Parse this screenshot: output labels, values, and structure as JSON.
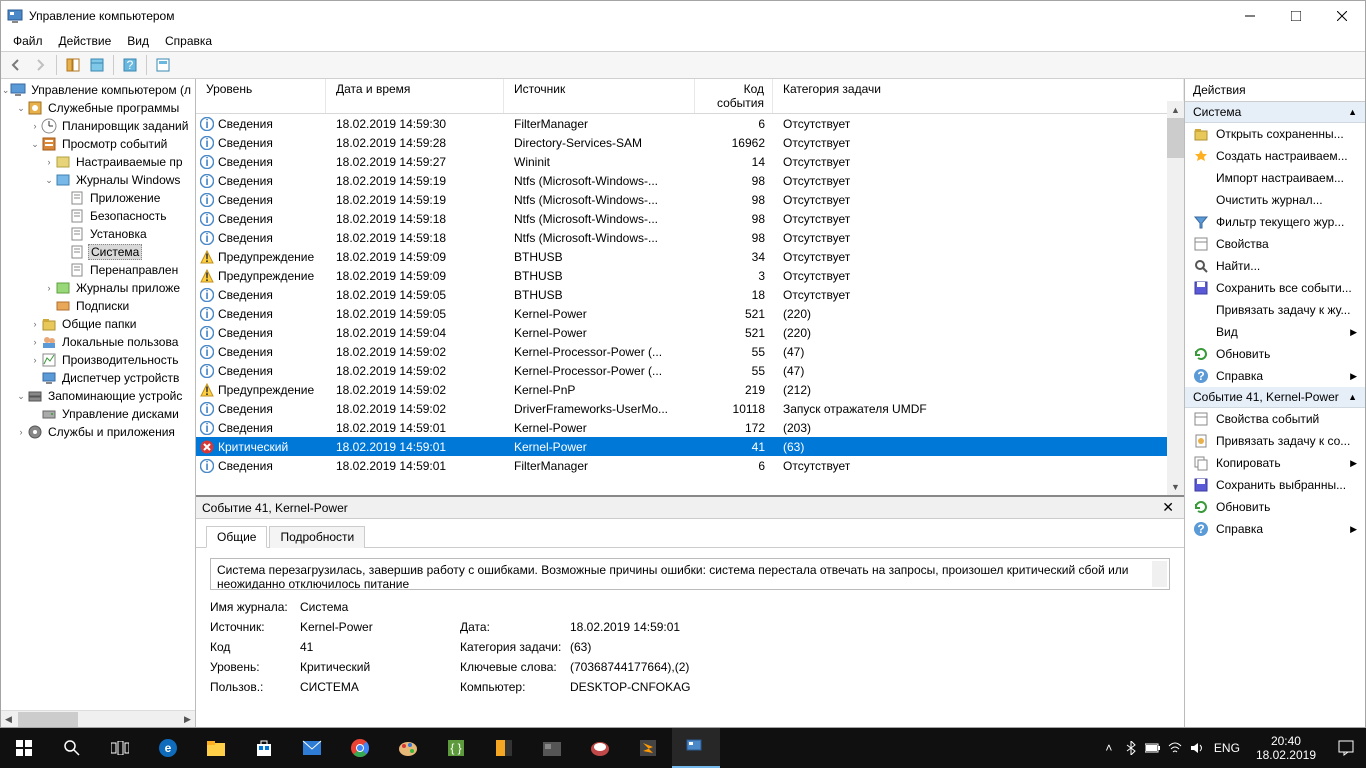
{
  "window": {
    "title": "Управление компьютером"
  },
  "menu": {
    "file": "Файл",
    "action": "Действие",
    "view": "Вид",
    "help": "Справка"
  },
  "tree": [
    {
      "d": 0,
      "exp": "v",
      "ico": "computer",
      "label": "Управление компьютером (л"
    },
    {
      "d": 1,
      "exp": "v",
      "ico": "tools",
      "label": "Служебные программы"
    },
    {
      "d": 2,
      "exp": ">",
      "ico": "sched",
      "label": "Планировщик заданий"
    },
    {
      "d": 2,
      "exp": "v",
      "ico": "event",
      "label": "Просмотр событий"
    },
    {
      "d": 3,
      "exp": ">",
      "ico": "custom",
      "label": "Настраиваемые пр"
    },
    {
      "d": 3,
      "exp": "v",
      "ico": "winlog",
      "label": "Журналы Windows"
    },
    {
      "d": 4,
      "exp": "",
      "ico": "log",
      "label": "Приложение"
    },
    {
      "d": 4,
      "exp": "",
      "ico": "log",
      "label": "Безопасность"
    },
    {
      "d": 4,
      "exp": "",
      "ico": "log",
      "label": "Установка"
    },
    {
      "d": 4,
      "exp": "",
      "ico": "log",
      "label": "Система",
      "sel": true
    },
    {
      "d": 4,
      "exp": "",
      "ico": "log",
      "label": "Перенаправлен"
    },
    {
      "d": 3,
      "exp": ">",
      "ico": "applog",
      "label": "Журналы приложе"
    },
    {
      "d": 3,
      "exp": "",
      "ico": "sub",
      "label": "Подписки"
    },
    {
      "d": 2,
      "exp": ">",
      "ico": "share",
      "label": "Общие папки"
    },
    {
      "d": 2,
      "exp": ">",
      "ico": "users",
      "label": "Локальные пользова"
    },
    {
      "d": 2,
      "exp": ">",
      "ico": "perf",
      "label": "Производительность"
    },
    {
      "d": 2,
      "exp": "",
      "ico": "devmgr",
      "label": "Диспетчер устройств"
    },
    {
      "d": 1,
      "exp": "v",
      "ico": "storage",
      "label": "Запоминающие устройс"
    },
    {
      "d": 2,
      "exp": "",
      "ico": "disk",
      "label": "Управление дисками"
    },
    {
      "d": 1,
      "exp": ">",
      "ico": "services",
      "label": "Службы и приложения"
    }
  ],
  "grid": {
    "headers": {
      "level": "Уровень",
      "date": "Дата и время",
      "source": "Источник",
      "code": "Код события",
      "cat": "Категория задачи"
    },
    "rows": [
      {
        "ico": "info",
        "level": "Сведения",
        "date": "18.02.2019 14:59:30",
        "source": "FilterManager",
        "code": "6",
        "cat": "Отсутствует"
      },
      {
        "ico": "info",
        "level": "Сведения",
        "date": "18.02.2019 14:59:28",
        "source": "Directory-Services-SAM",
        "code": "16962",
        "cat": "Отсутствует"
      },
      {
        "ico": "info",
        "level": "Сведения",
        "date": "18.02.2019 14:59:27",
        "source": "Wininit",
        "code": "14",
        "cat": "Отсутствует"
      },
      {
        "ico": "info",
        "level": "Сведения",
        "date": "18.02.2019 14:59:19",
        "source": "Ntfs (Microsoft-Windows-...",
        "code": "98",
        "cat": "Отсутствует"
      },
      {
        "ico": "info",
        "level": "Сведения",
        "date": "18.02.2019 14:59:19",
        "source": "Ntfs (Microsoft-Windows-...",
        "code": "98",
        "cat": "Отсутствует"
      },
      {
        "ico": "info",
        "level": "Сведения",
        "date": "18.02.2019 14:59:18",
        "source": "Ntfs (Microsoft-Windows-...",
        "code": "98",
        "cat": "Отсутствует"
      },
      {
        "ico": "info",
        "level": "Сведения",
        "date": "18.02.2019 14:59:18",
        "source": "Ntfs (Microsoft-Windows-...",
        "code": "98",
        "cat": "Отсутствует"
      },
      {
        "ico": "warn",
        "level": "Предупреждение",
        "date": "18.02.2019 14:59:09",
        "source": "BTHUSB",
        "code": "34",
        "cat": "Отсутствует"
      },
      {
        "ico": "warn",
        "level": "Предупреждение",
        "date": "18.02.2019 14:59:09",
        "source": "BTHUSB",
        "code": "3",
        "cat": "Отсутствует"
      },
      {
        "ico": "info",
        "level": "Сведения",
        "date": "18.02.2019 14:59:05",
        "source": "BTHUSB",
        "code": "18",
        "cat": "Отсутствует"
      },
      {
        "ico": "info",
        "level": "Сведения",
        "date": "18.02.2019 14:59:05",
        "source": "Kernel-Power",
        "code": "521",
        "cat": "(220)"
      },
      {
        "ico": "info",
        "level": "Сведения",
        "date": "18.02.2019 14:59:04",
        "source": "Kernel-Power",
        "code": "521",
        "cat": "(220)"
      },
      {
        "ico": "info",
        "level": "Сведения",
        "date": "18.02.2019 14:59:02",
        "source": "Kernel-Processor-Power (...",
        "code": "55",
        "cat": "(47)"
      },
      {
        "ico": "info",
        "level": "Сведения",
        "date": "18.02.2019 14:59:02",
        "source": "Kernel-Processor-Power (...",
        "code": "55",
        "cat": "(47)"
      },
      {
        "ico": "warn",
        "level": "Предупреждение",
        "date": "18.02.2019 14:59:02",
        "source": "Kernel-PnP",
        "code": "219",
        "cat": "(212)"
      },
      {
        "ico": "info",
        "level": "Сведения",
        "date": "18.02.2019 14:59:02",
        "source": "DriverFrameworks-UserMo...",
        "code": "10118",
        "cat": "Запуск отражателя UMDF"
      },
      {
        "ico": "info",
        "level": "Сведения",
        "date": "18.02.2019 14:59:01",
        "source": "Kernel-Power",
        "code": "172",
        "cat": "(203)"
      },
      {
        "ico": "crit",
        "level": "Критический",
        "date": "18.02.2019 14:59:01",
        "source": "Kernel-Power",
        "code": "41",
        "cat": "(63)",
        "sel": true
      },
      {
        "ico": "info",
        "level": "Сведения",
        "date": "18.02.2019 14:59:01",
        "source": "FilterManager",
        "code": "6",
        "cat": "Отсутствует"
      }
    ]
  },
  "detail": {
    "title": "Событие 41, Kernel-Power",
    "tabs": {
      "general": "Общие",
      "details": "Подробности"
    },
    "message": "Система перезагрузилась, завершив работу с ошибками. Возможные причины ошибки: система перестала отвечать на запросы, произошел критический сбой или неожиданно отключилось питание",
    "labels": {
      "log": "Имя журнала:",
      "source": "Источник:",
      "date": "Дата:",
      "code": "Код",
      "cat": "Категория задачи:",
      "level": "Уровень:",
      "keywords": "Ключевые слова:",
      "user": "Пользов.:",
      "computer": "Компьютер:"
    },
    "values": {
      "log": "Система",
      "source": "Kernel-Power",
      "date": "18.02.2019 14:59:01",
      "code": "41",
      "cat": "(63)",
      "level": "Критический",
      "keywords": "(70368744177664),(2)",
      "user": "СИСТЕМА",
      "computer": "DESKTOP-CNFOKAG"
    }
  },
  "actions": {
    "title": "Действия",
    "section1": "Система",
    "items1": [
      {
        "ico": "open",
        "label": "Открыть сохраненны..."
      },
      {
        "ico": "create",
        "label": "Создать настраиваем..."
      },
      {
        "ico": "none",
        "label": "Импорт настраиваем..."
      },
      {
        "ico": "none",
        "label": "Очистить журнал..."
      },
      {
        "ico": "filter",
        "label": "Фильтр текущего жур..."
      },
      {
        "ico": "props",
        "label": "Свойства"
      },
      {
        "ico": "find",
        "label": "Найти..."
      },
      {
        "ico": "save",
        "label": "Сохранить все событи..."
      },
      {
        "ico": "none",
        "label": "Привязать задачу к жу..."
      },
      {
        "ico": "none",
        "label": "Вид",
        "sub": true
      },
      {
        "ico": "refresh",
        "label": "Обновить"
      },
      {
        "ico": "help",
        "label": "Справка",
        "sub": true
      }
    ],
    "section2": "Событие 41, Kernel-Power",
    "items2": [
      {
        "ico": "props",
        "label": "Свойства событий"
      },
      {
        "ico": "attach",
        "label": "Привязать задачу к со..."
      },
      {
        "ico": "copy",
        "label": "Копировать",
        "sub": true
      },
      {
        "ico": "save",
        "label": "Сохранить выбранны..."
      },
      {
        "ico": "refresh",
        "label": "Обновить"
      },
      {
        "ico": "help",
        "label": "Справка",
        "sub": true
      }
    ]
  },
  "taskbar": {
    "lang": "ENG",
    "time": "20:40",
    "date": "18.02.2019"
  }
}
